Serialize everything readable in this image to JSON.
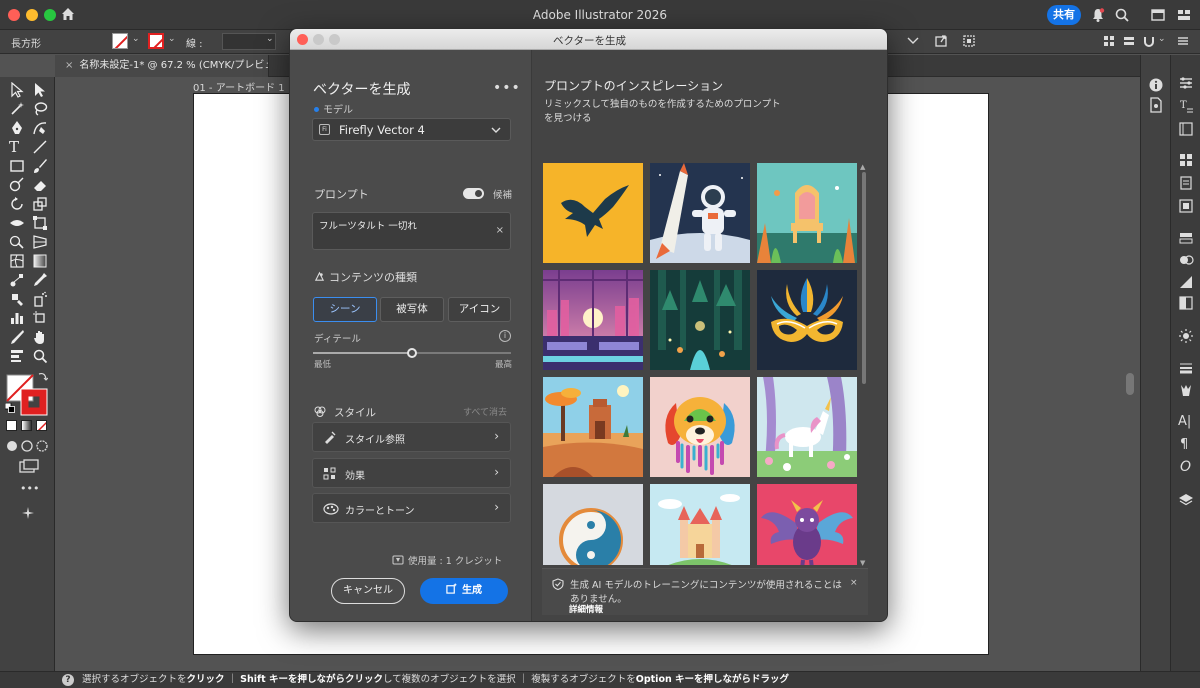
{
  "app": {
    "title": "Adobe Illustrator 2026",
    "share_label": "共有"
  },
  "control_bar": {
    "tool_name": "長方形",
    "stroke_label": "線 :"
  },
  "document": {
    "tab_title": "名称未設定-1* @ 67.2 % (CMYK/プレビュー)",
    "tab_close": "×",
    "artboard_label": "01 - アートボード 1"
  },
  "status_bar": {
    "help": "?",
    "part1": "選択するオブジェクトを",
    "part1_bold": "クリック",
    "sep1": "｜",
    "part2_bold": "Shift キーを押しながらクリック",
    "part2": "して複数のオブジェクトを選択",
    "sep2": "｜",
    "part3": "複製するオブジェクトを",
    "part3_bold": "Option キーを押しながらドラッグ"
  },
  "dialog": {
    "title": "ベクターを生成",
    "heading": "ベクターを生成",
    "more": "•••",
    "model_label": "モデル",
    "model_value": "Firefly Vector 4",
    "model_icon": "Fi",
    "prompt_label": "プロンプト",
    "suggest_label": "候補",
    "prompt_value": "フルーツタルト 一切れ",
    "prompt_clear": "×",
    "content_type_label": "コンテンツの種類",
    "content_types": [
      "シーン",
      "被写体",
      "アイコン"
    ],
    "detail_label": "ディテール",
    "detail_info": "i",
    "detail_min": "最低",
    "detail_max": "最高",
    "detail_level": 0.5,
    "style_label": "スタイル",
    "style_clear": "すべて消去",
    "style_rows": [
      "スタイル参照",
      "効果",
      "カラーとトーン"
    ],
    "credit_label": "使用量 : 1 クレジット",
    "cancel_label": "キャンセル",
    "generate_label": "生成"
  },
  "inspiration": {
    "title": "プロンプトのインスピレーション",
    "subtitle_line1": "リミックスして独自のものを作成するためのプロンプト",
    "subtitle_line2": "を見つける",
    "notice_line1": "生成 AI モデルのトレーニングにコンテンツが使用されることは",
    "notice_line2": "ありません。",
    "notice_link": "詳細情報",
    "notice_close": "×",
    "up_arrow": "▲",
    "down_arrow": "▼"
  },
  "colors": {
    "accent": "#1473e6",
    "panel": "#4a4a4a",
    "canvas": "#535353"
  }
}
